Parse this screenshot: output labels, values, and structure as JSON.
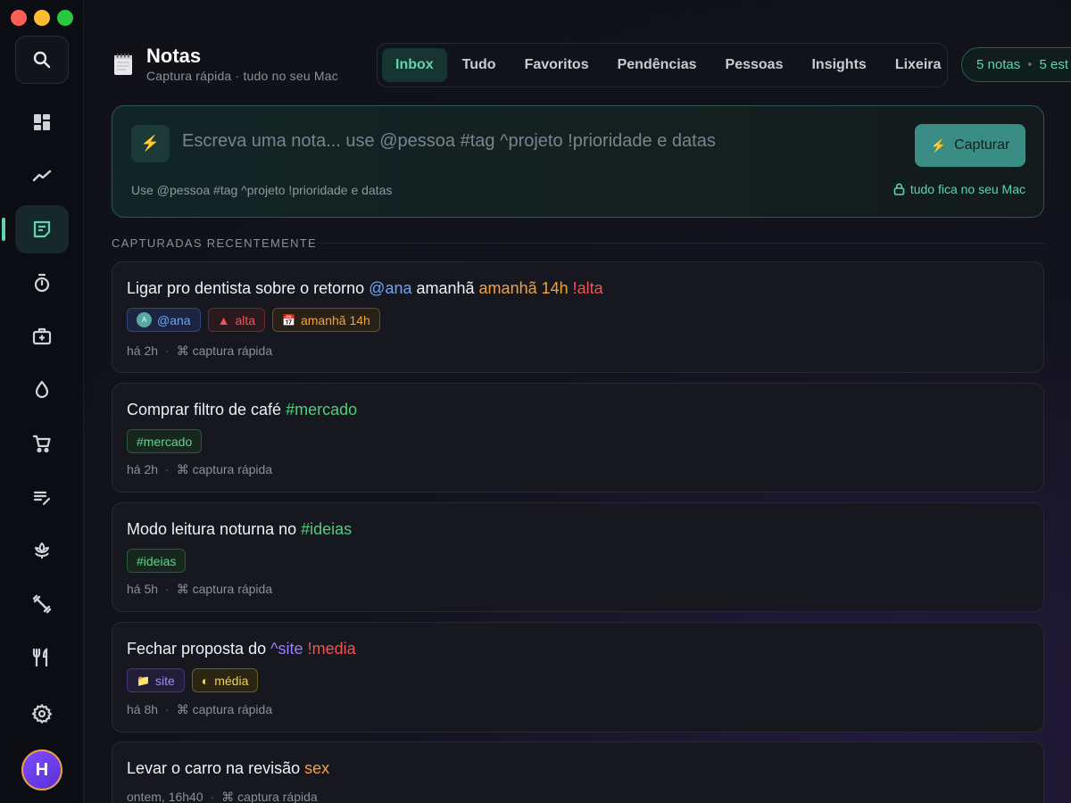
{
  "window": {
    "controls": [
      "close",
      "minimize",
      "maximize"
    ]
  },
  "sidebar": {
    "items": [
      {
        "name": "dashboard",
        "icon": "dashboard-icon"
      },
      {
        "name": "trends",
        "icon": "trend-line-icon"
      },
      {
        "name": "notes",
        "icon": "note-icon",
        "active": true
      },
      {
        "name": "timer",
        "icon": "stopwatch-icon"
      },
      {
        "name": "health",
        "icon": "medical-kit-icon"
      },
      {
        "name": "water",
        "icon": "water-drop-icon"
      },
      {
        "name": "shopping",
        "icon": "cart-icon"
      },
      {
        "name": "lists",
        "icon": "list-edit-icon"
      },
      {
        "name": "mindfulness",
        "icon": "lotus-icon"
      },
      {
        "name": "fitness",
        "icon": "dumbbell-icon"
      },
      {
        "name": "meals",
        "icon": "utensils-icon"
      },
      {
        "name": "settings",
        "icon": "gear-icon"
      }
    ],
    "avatar_initial": "H"
  },
  "header": {
    "title": "Notas",
    "subtitle": "Captura rápida · tudo no seu Mac"
  },
  "tabs": [
    {
      "label": "Inbox",
      "active": true
    },
    {
      "label": "Tudo"
    },
    {
      "label": "Favoritos"
    },
    {
      "label": "Pendências"
    },
    {
      "label": "Pessoas"
    },
    {
      "label": "Insights"
    },
    {
      "label": "Lixeira"
    }
  ],
  "stats": {
    "notes": "5 notas",
    "dot": "•",
    "other": "5 est"
  },
  "capture": {
    "icon": "⚡",
    "placeholder": "Escreva uma nota... use @pessoa #tag ^projeto !prioridade e datas",
    "button_icon": "⚡",
    "button_label": "Capturar",
    "hint": "Use @pessoa #tag ^projeto !prioridade e datas",
    "privacy": "tudo fica no seu Mac"
  },
  "section": {
    "label": "CAPTURADAS RECENTEMENTE"
  },
  "notes": [
    {
      "title_text": "Ligar pro dentista sobre o retorno ",
      "title_person": "@ana",
      "title_mid": " amanhã ",
      "title_date": "amanhã 14h",
      "title_space": " ",
      "title_prio": "!alta",
      "chip_person_initial": "A",
      "chip_person": "@ana",
      "chip_prio_icon": "▲",
      "chip_prio": "alta",
      "chip_date_icon": "📅",
      "chip_date": "amanhã 14h",
      "time": "há 2h",
      "sep": "·",
      "source": "⌘ captura rápida"
    },
    {
      "title_text": "Comprar filtro de café ",
      "title_tag": "#mercado",
      "chip_tag": "#mercado",
      "time": "há 2h",
      "sep": "·",
      "source": "⌘ captura rápida"
    },
    {
      "title_text": "Modo leitura noturna no ",
      "title_tag": "#ideias",
      "chip_tag": "#ideias",
      "time": "há 5h",
      "sep": "·",
      "source": "⌘ captura rápida"
    },
    {
      "title_text": "Fechar proposta do ",
      "title_project": "^site",
      "title_space": " ",
      "title_prio": "!media",
      "chip_project_icon": "📁",
      "chip_project": "site",
      "chip_prio_icon": "◐",
      "chip_prio": "média",
      "time": "há 8h",
      "sep": "·",
      "source": "⌘ captura rápida"
    },
    {
      "title_text": "Levar o carro na revisão ",
      "title_date": "sex",
      "time": "ontem, 16h40",
      "sep": "·",
      "source": "⌘ captura rápida"
    }
  ],
  "colors": {
    "accent": "#5fd4b0",
    "person": "#6aa5ff",
    "date": "#f0a33c",
    "priority_high": "#ef5454",
    "tag": "#4fcf7c",
    "project": "#9b7cff",
    "priority_mid": "#f2d24c"
  }
}
